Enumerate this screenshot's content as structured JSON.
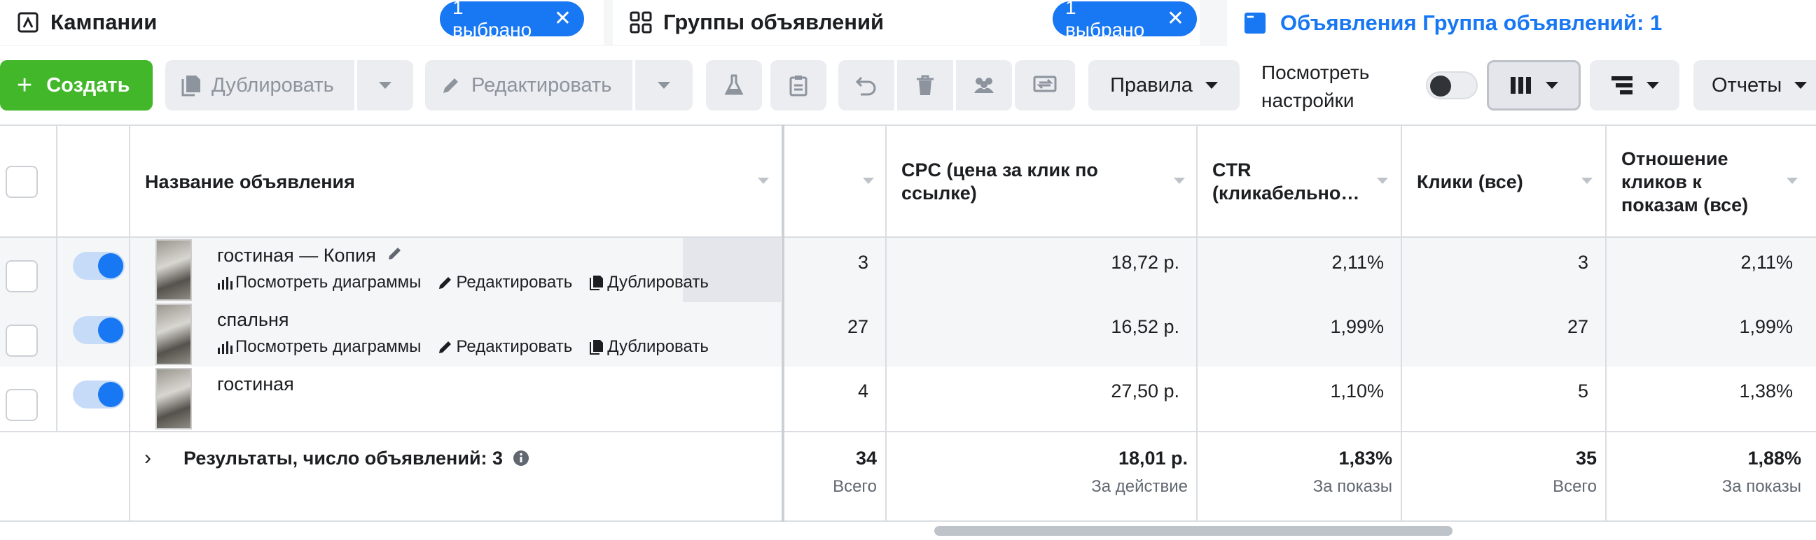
{
  "tabs": {
    "campaigns": {
      "label": "Кампании",
      "chip": "1 выбрано"
    },
    "adsets": {
      "label": "Группы объявлений",
      "chip": "1 выбрано"
    },
    "ads": {
      "label": "Объявления Группа объявлений: 1"
    }
  },
  "toolbar": {
    "create": "Создать",
    "duplicate": "Дублировать",
    "edit": "Редактировать",
    "rules": "Правила",
    "view_settings_line1": "Посмотреть",
    "view_settings_line2": "настройки",
    "reports": "Отчеты"
  },
  "table": {
    "headers": {
      "name": "Название объявления",
      "col1": "",
      "cpc": "CPC (цена за клик по ссылке)",
      "ctr": "CTR (кликабельно…",
      "clicks": "Клики (все)",
      "ctr_all": "Отношение кликов к показам (все)"
    },
    "row_actions": {
      "charts": "Посмотреть диаграммы",
      "edit": "Редактировать",
      "duplicate": "Дублировать"
    },
    "rows": [
      {
        "name": "гостиная — Копия",
        "c1": "3",
        "cpc": "18,72 р.",
        "ctr": "2,11%",
        "clicks": "3",
        "ctr_all": "2,11%"
      },
      {
        "name": "спальня",
        "c1": "27",
        "cpc": "16,52 р.",
        "ctr": "1,99%",
        "clicks": "27",
        "ctr_all": "1,99%"
      },
      {
        "name": "гостиная",
        "c1": "4",
        "cpc": "27,50 р.",
        "ctr": "1,10%",
        "clicks": "5",
        "ctr_all": "1,38%"
      }
    ],
    "summary": {
      "title": "Результаты, число объявлений: 3",
      "c1": "34",
      "c1_sub": "Всего",
      "cpc": "18,01 р.",
      "cpc_sub": "За действие",
      "ctr": "1,83%",
      "ctr_sub": "За показы",
      "clicks": "35",
      "clicks_sub": "Всего",
      "ctr_all": "1,88%",
      "ctr_all_sub": "За показы"
    }
  },
  "colors": {
    "accent": "#1877f2",
    "create": "#42b72a",
    "border": "#dadde1"
  }
}
